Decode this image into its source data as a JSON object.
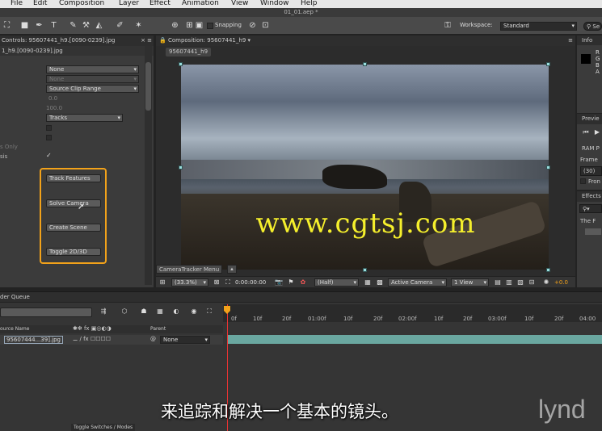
{
  "menu": [
    "File",
    "Edit",
    "Composition",
    "Layer",
    "Effect",
    "Animation",
    "View",
    "Window",
    "Help"
  ],
  "window_title": "01_01.aep *",
  "toolbar": {
    "snapping": "Snapping",
    "workspace_label": "Workspace:",
    "workspace_value": "Standard",
    "search_placeholder": "Se"
  },
  "effect_controls": {
    "tab": "Controls: 95607441_h9.[0090-0239].jpg",
    "layer": "1_h9.[0090-0239].jpg",
    "dropdown1": "None",
    "dropdown2": "None",
    "dropdown3": "Source Clip Range",
    "value1": "0.0",
    "value2": "100.0",
    "dropdown4": "Tracks",
    "label_only": "s Only",
    "label_sis": "sis",
    "check": "✓",
    "buttons": [
      "Track Features",
      "Solve Camera",
      "Create Scene",
      "Toggle 2D/3D"
    ]
  },
  "composition": {
    "tab": "Composition: 95607441_h9",
    "sub_tab": "95607441_h9",
    "menu_button": "CameraTracker Menu",
    "zoom": "(33.3%)",
    "timecode": "0:00:00:00",
    "resolution": "(Half)",
    "camera": "Active Camera",
    "views": "1 View",
    "exposure": "+0.0"
  },
  "info": {
    "tab": "Info",
    "rgb": [
      "R",
      "G",
      "B",
      "A"
    ]
  },
  "preview": {
    "tab": "Previe",
    "ram": "RAM P",
    "frame_label": "Frame",
    "frame_value": "(30)",
    "from": "Fron"
  },
  "effects": {
    "tab": "Effects",
    "item": "The F"
  },
  "render_queue": {
    "tab": "der Queue"
  },
  "timeline": {
    "ticks": [
      "0f",
      "10f",
      "20f",
      "01:00f",
      "10f",
      "20f",
      "02:00f",
      "10f",
      "20f",
      "03:00f",
      "10f",
      "20f",
      "04:00"
    ],
    "col_source": "ource Name",
    "col_parent": "Parent",
    "layer_name": "95607444...39].jpg",
    "parent_value": "None",
    "toggle": "Toggle Switches / Modes"
  },
  "watermark": "www.cgtsj.com",
  "subtitle": "来追踪和解决一个基本的镜头。",
  "brand": "lynd"
}
